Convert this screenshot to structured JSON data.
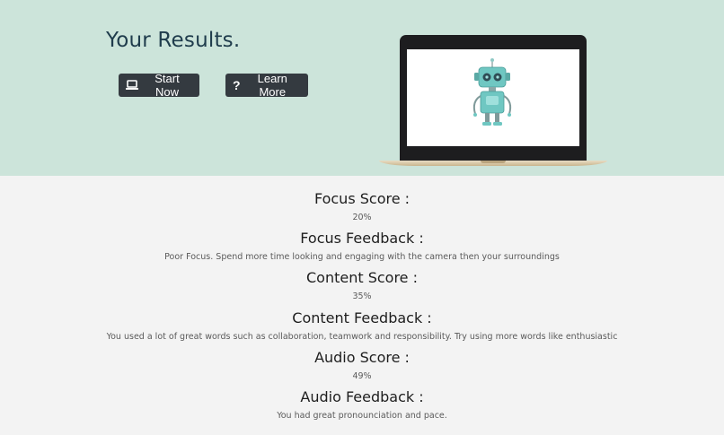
{
  "hero": {
    "title": "Your Results.",
    "start_label": "Start Now",
    "learn_label": "Learn More"
  },
  "results": {
    "focus_score_label": "Focus Score :",
    "focus_score_value": "20%",
    "focus_feedback_label": "Focus Feedback :",
    "focus_feedback_value": "Poor Focus. Spend more time looking and engaging with the camera then your surroundings",
    "content_score_label": "Content Score :",
    "content_score_value": "35%",
    "content_feedback_label": "Content Feedback :",
    "content_feedback_value": "You used a lot of great words such as collaboration, teamwork and responsibility. Try using more words like enthusiastic",
    "audio_score_label": "Audio Score :",
    "audio_score_value": "49%",
    "audio_feedback_label": "Audio Feedback :",
    "audio_feedback_value": "You had great pronounciation and pace."
  },
  "colors": {
    "hero_bg": "#cce4da",
    "page_bg": "#f3f3f3",
    "button_bg": "#343a40",
    "title_color": "#1f3c4c",
    "robot_teal": "#6fc7c2"
  },
  "icons": {
    "start": "laptop-icon",
    "learn": "question-icon",
    "illustration": "robot-illustration"
  }
}
